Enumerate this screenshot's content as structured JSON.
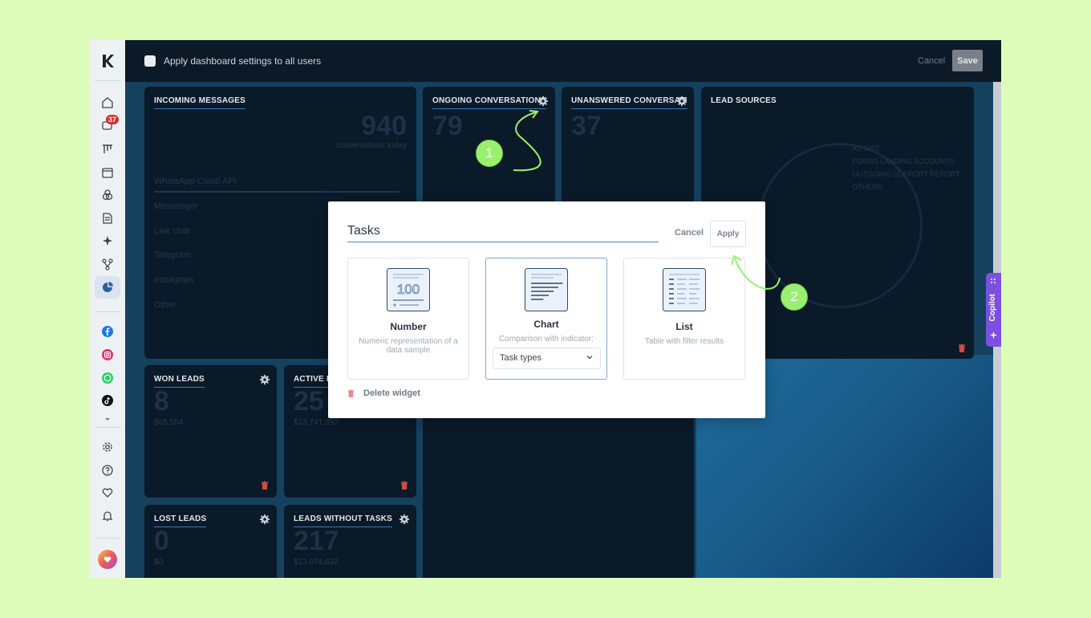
{
  "topbar": {
    "apply_label": "Apply dashboard settings to all users",
    "cancel": "Cancel",
    "save": "Save"
  },
  "sidebar": {
    "badge_count": "37",
    "icons": [
      "home-icon",
      "chat-icon",
      "kanban-icon",
      "calendar-icon",
      "contacts-icon",
      "document-icon",
      "ai-sparkle-icon",
      "pipeline-icon",
      "analytics-icon",
      "facebook-icon",
      "instagram-icon",
      "whatsapp-icon",
      "tiktok-icon",
      "settings-icon",
      "help-icon",
      "heart-icon",
      "bell-icon"
    ]
  },
  "widgets": {
    "incoming": {
      "title": "INCOMING MESSAGES",
      "value": "940",
      "sub": "conversations today",
      "items": [
        "WhatsApp Cloud API",
        "Messenger",
        "Live chat",
        "Telegram",
        "Instagram",
        "Other"
      ]
    },
    "ongoing": {
      "title": "ONGOING CONVERSATIONS",
      "value": "79"
    },
    "unanswered": {
      "title": "UNANSWERED CONVERSATI",
      "value": "37"
    },
    "lead_sources": {
      "title": "LEAD SOURCES",
      "legend": [
        "AD SITE",
        "FORMS LANDING ACCOUNTS",
        "OUTGOING SUPPORT REPORT",
        "OTHERS"
      ]
    },
    "won": {
      "title": "WON LEADS",
      "value": "8",
      "sub": "$65,554"
    },
    "active": {
      "title": "ACTIVE L",
      "value": "25",
      "sub": "$13,741,392"
    },
    "lost": {
      "title": "LOST LEADS",
      "value": "0",
      "sub": "$0"
    },
    "no_tasks": {
      "title": "LEADS WITHOUT TASKS",
      "value": "217",
      "sub": "$13,074,632"
    }
  },
  "modal": {
    "title_value": "Tasks",
    "cancel": "Cancel",
    "apply": "Apply",
    "cards": [
      {
        "title": "Number",
        "desc": "Numeric representation of a data sample",
        "icon_text": "100"
      },
      {
        "title": "Chart",
        "desc": "Comparison with indicator:",
        "select_value": "Task types"
      },
      {
        "title": "List",
        "desc": "Table with filter results"
      }
    ],
    "delete": "Delete widget"
  },
  "steps": [
    "1",
    "2"
  ],
  "copilot": "Copilot",
  "colors": {
    "accent": "#9af06e",
    "primary": "#4b84c4",
    "copilot": "#7b4fe0",
    "badge": "#d2312f"
  }
}
